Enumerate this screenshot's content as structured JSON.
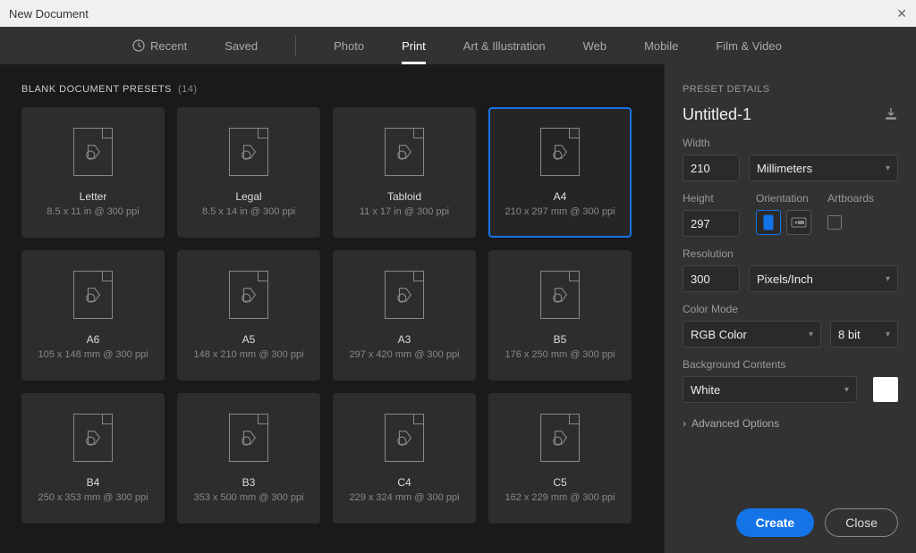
{
  "window": {
    "title": "New Document"
  },
  "tabs": {
    "recent": "Recent",
    "saved": "Saved",
    "photo": "Photo",
    "print": "Print",
    "art": "Art & Illustration",
    "web": "Web",
    "mobile": "Mobile",
    "film": "Film & Video",
    "active": "print"
  },
  "presets_header": {
    "label": "BLANK DOCUMENT PRESETS",
    "count": "(14)"
  },
  "presets": [
    {
      "name": "Letter",
      "dims": "8.5 x 11 in @ 300 ppi",
      "selected": false
    },
    {
      "name": "Legal",
      "dims": "8.5 x 14 in @ 300 ppi",
      "selected": false
    },
    {
      "name": "Tabloid",
      "dims": "11 x 17 in @ 300 ppi",
      "selected": false
    },
    {
      "name": "A4",
      "dims": "210 x 297 mm @ 300 ppi",
      "selected": true
    },
    {
      "name": "A6",
      "dims": "105 x 148 mm @ 300 ppi",
      "selected": false
    },
    {
      "name": "A5",
      "dims": "148 x 210 mm @ 300 ppi",
      "selected": false
    },
    {
      "name": "A3",
      "dims": "297 x 420 mm @ 300 ppi",
      "selected": false
    },
    {
      "name": "B5",
      "dims": "176 x 250 mm @ 300 ppi",
      "selected": false
    },
    {
      "name": "B4",
      "dims": "250 x 353 mm @ 300 ppi",
      "selected": false
    },
    {
      "name": "B3",
      "dims": "353 x 500 mm @ 300 ppi",
      "selected": false
    },
    {
      "name": "C4",
      "dims": "229 x 324 mm @ 300 ppi",
      "selected": false
    },
    {
      "name": "C5",
      "dims": "162 x 229 mm @ 300 ppi",
      "selected": false
    }
  ],
  "details": {
    "panel_title": "PRESET DETAILS",
    "doc_title": "Untitled-1",
    "width_label": "Width",
    "width_value": "210",
    "unit": "Millimeters",
    "height_label": "Height",
    "height_value": "297",
    "orientation_label": "Orientation",
    "artboards_label": "Artboards",
    "resolution_label": "Resolution",
    "resolution_value": "300",
    "resolution_unit": "Pixels/Inch",
    "colormode_label": "Color Mode",
    "colormode_value": "RGB Color",
    "colordepth": "8 bit",
    "bg_label": "Background Contents",
    "bg_value": "White",
    "advanced": "Advanced Options"
  },
  "buttons": {
    "create": "Create",
    "close": "Close"
  }
}
